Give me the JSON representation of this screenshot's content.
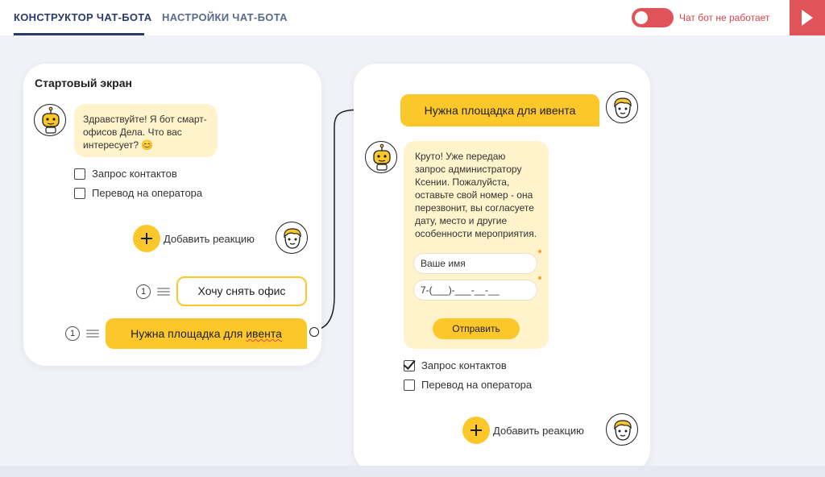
{
  "header": {
    "tabs": [
      {
        "label": "КОНСТРУКТОР ЧАТ-БОТА",
        "active": true
      },
      {
        "label": "НАСТРОЙКИ ЧАТ-БОТА",
        "active": false
      }
    ],
    "bot_status": "Чат бот не работает",
    "toggle_on": false,
    "accent_color": "#e05358"
  },
  "start_card": {
    "title": "Стартовый экран",
    "bot_avatar_icon": "robot-icon",
    "bot_message": "Здравствуйте! Я бот смарт-офисов Дела. Что вас интересует? 😊",
    "checkboxes": [
      {
        "label": "Запрос контактов",
        "checked": false
      },
      {
        "label": "Перевод на оператора",
        "checked": false
      }
    ],
    "add_reaction_label": "Добавить реакцию",
    "user_avatar_icon": "user-face-icon",
    "replies": [
      {
        "number": "1",
        "label": "Хочу снять офис",
        "style": "outline"
      },
      {
        "number": "1",
        "label_before": "Нужна площадка для ",
        "label_word": "ивента",
        "style": "filled"
      }
    ]
  },
  "event_card": {
    "user_message": "Нужна площадка для ивента",
    "bot_message": "Круто! Уже передаю запрос администратору Ксении. Пожалуйста, оставьте свой номер - она перезвонит, вы согласуете дату, место и другие особенности мероприятия.",
    "form": {
      "name_placeholder": "Ваше имя",
      "phone_placeholder": "7-(___)-___-__-__",
      "submit_label": "Отправить"
    },
    "checkboxes": [
      {
        "label": "Запрос контактов",
        "checked": true
      },
      {
        "label": "Перевод на оператора",
        "checked": false
      }
    ],
    "add_reaction_label": "Добавить реакцию"
  },
  "colors": {
    "brand_yellow": "#fcc72a",
    "bubble_bg": "#fff3cc",
    "nav_text": "#2b3a6b"
  }
}
